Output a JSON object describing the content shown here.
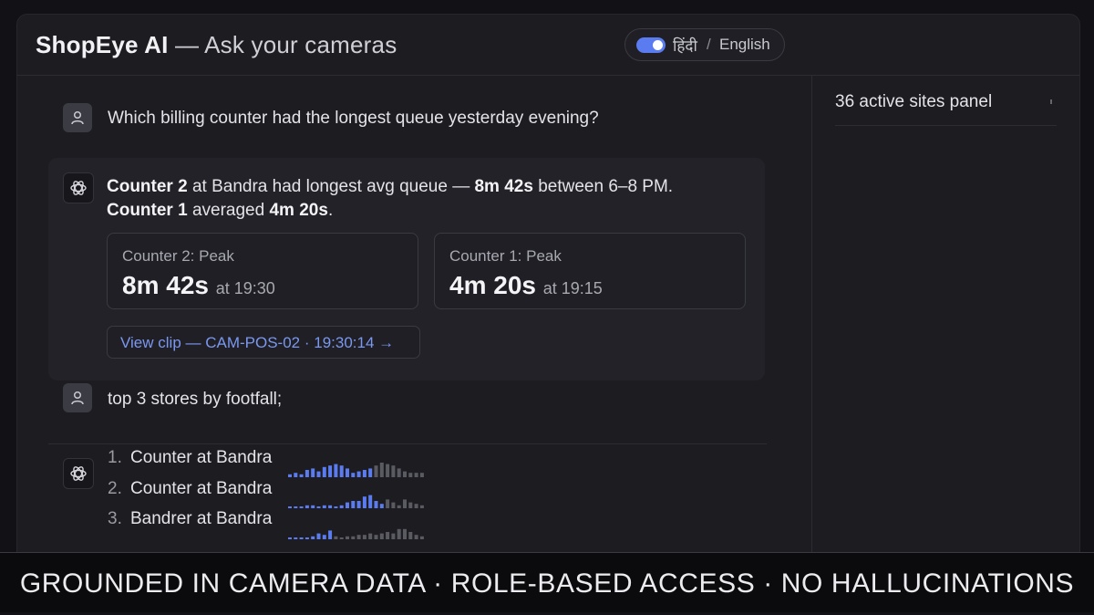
{
  "header": {
    "brand": "ShopEye AI",
    "subtitle": "— Ask your cameras",
    "lang_hindi": "हिंदी",
    "lang_sep": "/",
    "lang_english": "English"
  },
  "sidebar": {
    "title": "36 active sites panel"
  },
  "chat": {
    "q1": "Which billing counter had the longest queue yesterday evening?",
    "a1": {
      "l1_b1": "Counter 2",
      "l1_t1": " at Bandra had longest avg queue — ",
      "l1_b2": "8m 42s",
      "l1_t2": " between 6–8 PM.",
      "l2_b1": "Counter 1",
      "l2_t1": " averaged ",
      "l2_b2": "4m 20s",
      "l2_t2": ".",
      "stats": [
        {
          "label": "Counter 2: Peak",
          "value": "8m 42s",
          "at": "at 19:30"
        },
        {
          "label": "Counter 1: Peak",
          "value": "4m 20s",
          "at": "at 19:15"
        }
      ],
      "clip": "View clip — CAM-POS-02 · 19:30:14 →"
    },
    "q2": "top 3 stores by footfall;",
    "a2": {
      "items": [
        {
          "num": "1.",
          "name": "Counter at Bandra"
        },
        {
          "num": "2.",
          "name": "Counter at Bandra"
        },
        {
          "num": "3.",
          "name": "Bandrer at Bandra"
        }
      ]
    }
  },
  "sparklines": [
    [
      2,
      3,
      2,
      5,
      6,
      4,
      7,
      8,
      9,
      8,
      6,
      3,
      4,
      5,
      6,
      8,
      10,
      9,
      8,
      6,
      4,
      3,
      3,
      3
    ],
    [
      1,
      1,
      1,
      2,
      2,
      1,
      2,
      2,
      1,
      2,
      4,
      5,
      5,
      8,
      9,
      5,
      3,
      6,
      4,
      2,
      6,
      4,
      3,
      2
    ],
    [
      1,
      1,
      1,
      1,
      2,
      4,
      3,
      6,
      2,
      1,
      2,
      2,
      3,
      3,
      4,
      3,
      4,
      5,
      4,
      7,
      7,
      5,
      3,
      2
    ]
  ],
  "spark_split": [
    15,
    17,
    8
  ],
  "colors": {
    "accent": "#5b7bf0",
    "link": "#7b98f0",
    "spark_active": "#5b7bf0",
    "spark_inactive": "#5a5a62"
  },
  "banner": "GROUNDED IN CAMERA DATA · ROLE-BASED ACCESS · NO HALLUCINATIONS"
}
